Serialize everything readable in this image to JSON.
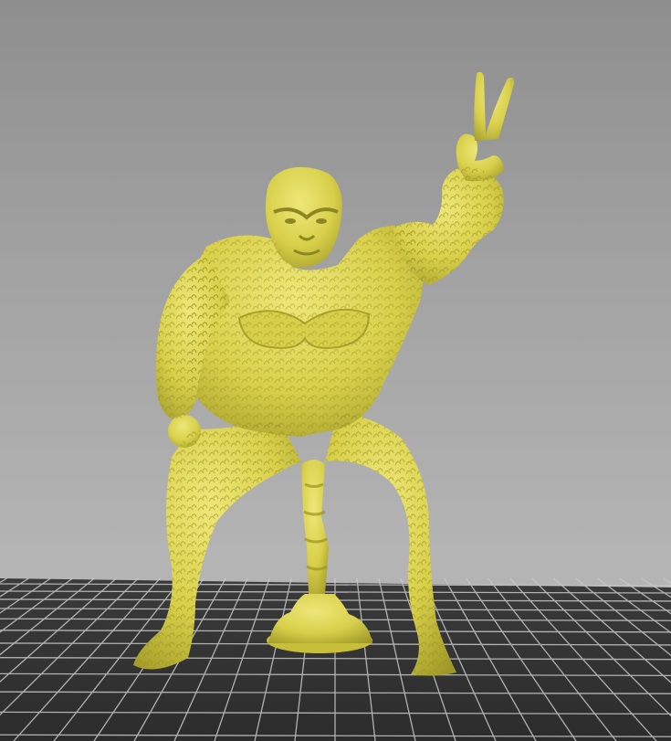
{
  "viewport": {
    "background_top": "#8e8e8e",
    "background_bottom": "#b8b8b8",
    "build_plate_color": "#3b3b3b",
    "grid_line_color": "#c9c9c9"
  },
  "model": {
    "name_icon": "gorilla-figure-icon",
    "color": "#d8d04a",
    "shadow_color": "#8d8721",
    "highlight_color": "#eee779"
  }
}
